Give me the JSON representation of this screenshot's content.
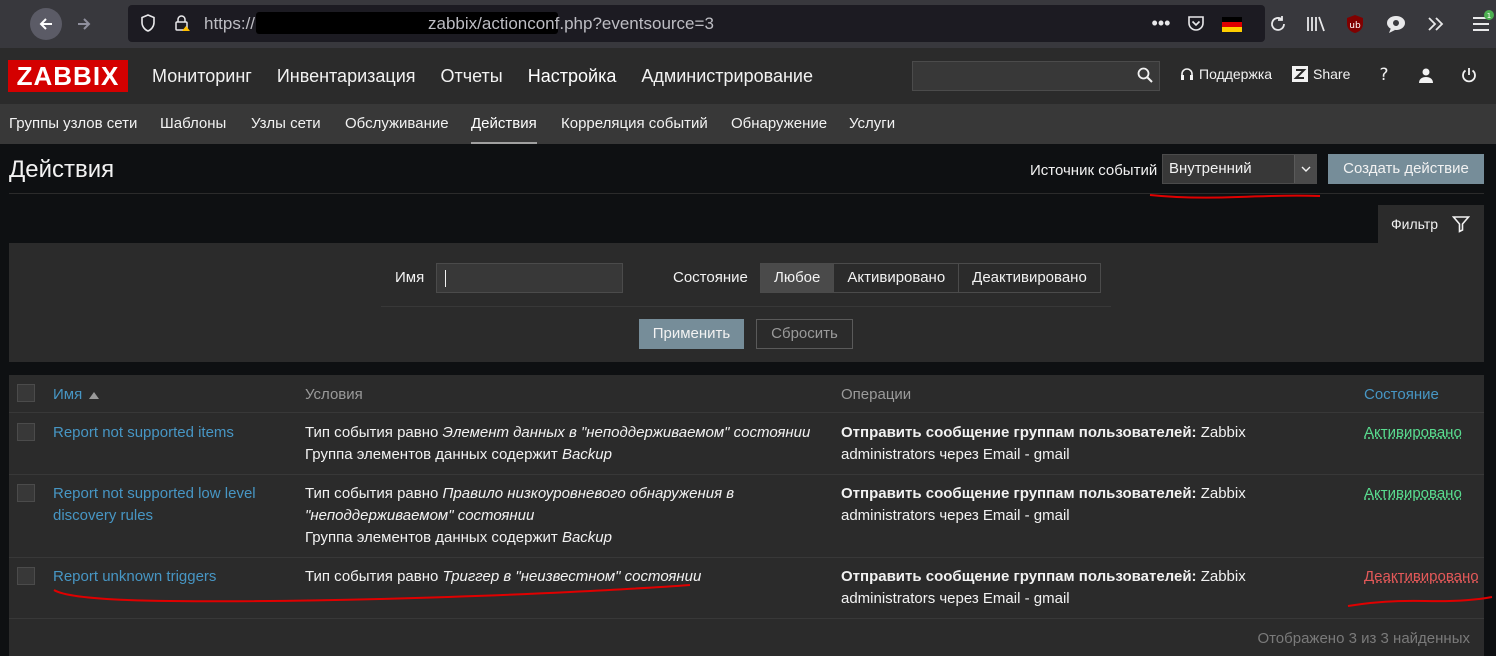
{
  "browser": {
    "url_prefix": "https://",
    "url_rest": "zabbix/actionconf.php?eventsource=3"
  },
  "header": {
    "logo": "ZABBIX",
    "menu": [
      "Мониторинг",
      "Инвентаризация",
      "Отчеты",
      "Настройка",
      "Администрирование"
    ],
    "support": "Поддержка",
    "share": "Share",
    "help": "?"
  },
  "subnav": {
    "items": [
      "Группы узлов сети",
      "Шаблоны",
      "Узлы сети",
      "Обслуживание",
      "Действия",
      "Корреляция событий",
      "Обнаружение",
      "Услуги"
    ]
  },
  "page": {
    "title": "Действия",
    "source_label": "Источник событий",
    "source_value": "Внутренний",
    "create_button": "Создать действие"
  },
  "filter": {
    "tab_label": "Фильтр",
    "name_label": "Имя",
    "name_value": "",
    "state_label": "Состояние",
    "state_options": [
      "Любое",
      "Активировано",
      "Деактивировано"
    ],
    "apply": "Применить",
    "reset": "Сбросить"
  },
  "table": {
    "headers": {
      "name": "Имя",
      "conditions": "Условия",
      "operations": "Операции",
      "status": "Состояние"
    },
    "rows": [
      {
        "name": "Report not supported items",
        "cond1_prefix": "Тип события равно ",
        "cond1_value": "Элемент данных в \"неподдерживаемом\" состоянии",
        "cond2_prefix": "Группа элементов данных содержит ",
        "cond2_value": "Backup",
        "op_bold": "Отправить сообщение группам пользователей:",
        "op_rest1": " Zabbix",
        "op_rest2": "administrators через Email - gmail",
        "status": "Активировано"
      },
      {
        "name_line1": "Report not supported low level",
        "name_line2": "discovery rules",
        "cond1_prefix": "Тип события равно ",
        "cond1_value_a": "Правило низкоуровневого обнаружения в",
        "cond1_value_b": "\"неподдерживаемом\" состоянии",
        "cond2_prefix": "Группа элементов данных содержит ",
        "cond2_value": "Backup",
        "op_bold": "Отправить сообщение группам пользователей:",
        "op_rest1": " Zabbix",
        "op_rest2": "administrators через Email - gmail",
        "status": "Активировано"
      },
      {
        "name": "Report unknown triggers",
        "cond1_prefix": "Тип события равно ",
        "cond1_value": "Триггер в \"неизвестном\" состоянии",
        "op_bold": "Отправить сообщение группам пользователей:",
        "op_rest1": " Zabbix",
        "op_rest2": "administrators через Email - gmail",
        "status": "Деактивировано"
      }
    ],
    "footer": "Отображено 3 из 3 найденных"
  },
  "colors": {
    "enabled": "#59db8f",
    "disabled": "#e45959",
    "link": "#4796c4",
    "accent_button": "#768d99",
    "annotation": "#e00000"
  }
}
